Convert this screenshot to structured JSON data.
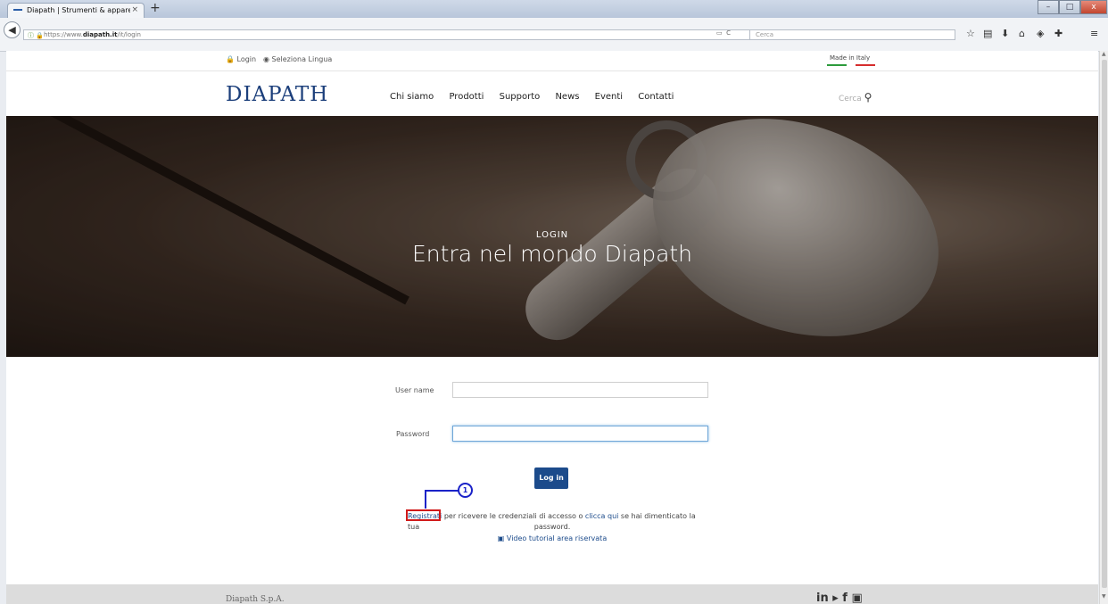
{
  "browser": {
    "tab_title": "Diapath | Strumenti & appare",
    "tab_close": "×",
    "new_tab": "+",
    "url_prefix": "https://www.",
    "url_domain": "diapath.it",
    "url_path": "/it/login",
    "search_placeholder": "Cerca",
    "window_min": "–",
    "window_max": "□",
    "window_close": "x"
  },
  "topbar": {
    "login": "Login",
    "language": "Seleziona Lingua",
    "made_in": "Made in Italy"
  },
  "header": {
    "logo": "DIAPATH",
    "nav": [
      "Chi siamo",
      "Prodotti",
      "Supporto",
      "News",
      "Eventi",
      "Contatti"
    ],
    "search": "Cerca"
  },
  "hero": {
    "eyebrow": "LOGIN",
    "headline": "Entra nel mondo Diapath"
  },
  "form": {
    "username_label": "User name",
    "password_label": "Password",
    "username_value": "",
    "password_value": "",
    "login_button": "Log in",
    "register_link": "Registrati",
    "register_text_1": " per ricevere le credenziali di accesso o ",
    "click_link": "clicca qui",
    "register_text_2": " se hai dimenticato la tua",
    "password_word": "password.",
    "video_link": "Video tutorial area riservata"
  },
  "annotation": {
    "step_number": "1",
    "marker_color": "#1a22c8",
    "highlight_color": "#d11a1a"
  },
  "footer": {
    "company": "Diapath S.p.A.",
    "social": "in ▸ f ▣"
  },
  "colors": {
    "brand": "#1c3f7b",
    "button": "#1c4b8b"
  }
}
